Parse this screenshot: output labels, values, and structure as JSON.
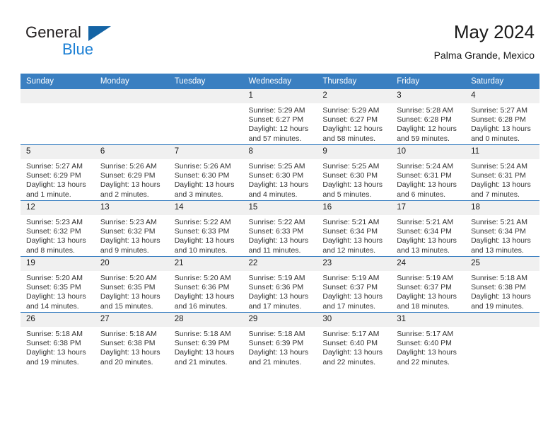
{
  "brand": {
    "name_part1": "General",
    "name_part2": "Blue",
    "triangle_color": "#1464a5",
    "blue_color": "#1b7fd4"
  },
  "header": {
    "title": "May 2024",
    "subtitle": "Palma Grande, Mexico"
  },
  "theme": {
    "header_row_bg": "#3a7fc1",
    "daynum_bg": "#f0f0f0",
    "text_color": "#1a1a1a"
  },
  "calendar": {
    "weekday_headers": [
      "Sunday",
      "Monday",
      "Tuesday",
      "Wednesday",
      "Thursday",
      "Friday",
      "Saturday"
    ],
    "weeks": [
      [
        {
          "day": "",
          "sunrise": "",
          "sunset": "",
          "daylight1": "",
          "daylight2": ""
        },
        {
          "day": "",
          "sunrise": "",
          "sunset": "",
          "daylight1": "",
          "daylight2": ""
        },
        {
          "day": "",
          "sunrise": "",
          "sunset": "",
          "daylight1": "",
          "daylight2": ""
        },
        {
          "day": "1",
          "sunrise": "Sunrise: 5:29 AM",
          "sunset": "Sunset: 6:27 PM",
          "daylight1": "Daylight: 12 hours",
          "daylight2": "and 57 minutes."
        },
        {
          "day": "2",
          "sunrise": "Sunrise: 5:29 AM",
          "sunset": "Sunset: 6:27 PM",
          "daylight1": "Daylight: 12 hours",
          "daylight2": "and 58 minutes."
        },
        {
          "day": "3",
          "sunrise": "Sunrise: 5:28 AM",
          "sunset": "Sunset: 6:28 PM",
          "daylight1": "Daylight: 12 hours",
          "daylight2": "and 59 minutes."
        },
        {
          "day": "4",
          "sunrise": "Sunrise: 5:27 AM",
          "sunset": "Sunset: 6:28 PM",
          "daylight1": "Daylight: 13 hours",
          "daylight2": "and 0 minutes."
        }
      ],
      [
        {
          "day": "5",
          "sunrise": "Sunrise: 5:27 AM",
          "sunset": "Sunset: 6:29 PM",
          "daylight1": "Daylight: 13 hours",
          "daylight2": "and 1 minute."
        },
        {
          "day": "6",
          "sunrise": "Sunrise: 5:26 AM",
          "sunset": "Sunset: 6:29 PM",
          "daylight1": "Daylight: 13 hours",
          "daylight2": "and 2 minutes."
        },
        {
          "day": "7",
          "sunrise": "Sunrise: 5:26 AM",
          "sunset": "Sunset: 6:30 PM",
          "daylight1": "Daylight: 13 hours",
          "daylight2": "and 3 minutes."
        },
        {
          "day": "8",
          "sunrise": "Sunrise: 5:25 AM",
          "sunset": "Sunset: 6:30 PM",
          "daylight1": "Daylight: 13 hours",
          "daylight2": "and 4 minutes."
        },
        {
          "day": "9",
          "sunrise": "Sunrise: 5:25 AM",
          "sunset": "Sunset: 6:30 PM",
          "daylight1": "Daylight: 13 hours",
          "daylight2": "and 5 minutes."
        },
        {
          "day": "10",
          "sunrise": "Sunrise: 5:24 AM",
          "sunset": "Sunset: 6:31 PM",
          "daylight1": "Daylight: 13 hours",
          "daylight2": "and 6 minutes."
        },
        {
          "day": "11",
          "sunrise": "Sunrise: 5:24 AM",
          "sunset": "Sunset: 6:31 PM",
          "daylight1": "Daylight: 13 hours",
          "daylight2": "and 7 minutes."
        }
      ],
      [
        {
          "day": "12",
          "sunrise": "Sunrise: 5:23 AM",
          "sunset": "Sunset: 6:32 PM",
          "daylight1": "Daylight: 13 hours",
          "daylight2": "and 8 minutes."
        },
        {
          "day": "13",
          "sunrise": "Sunrise: 5:23 AM",
          "sunset": "Sunset: 6:32 PM",
          "daylight1": "Daylight: 13 hours",
          "daylight2": "and 9 minutes."
        },
        {
          "day": "14",
          "sunrise": "Sunrise: 5:22 AM",
          "sunset": "Sunset: 6:33 PM",
          "daylight1": "Daylight: 13 hours",
          "daylight2": "and 10 minutes."
        },
        {
          "day": "15",
          "sunrise": "Sunrise: 5:22 AM",
          "sunset": "Sunset: 6:33 PM",
          "daylight1": "Daylight: 13 hours",
          "daylight2": "and 11 minutes."
        },
        {
          "day": "16",
          "sunrise": "Sunrise: 5:21 AM",
          "sunset": "Sunset: 6:34 PM",
          "daylight1": "Daylight: 13 hours",
          "daylight2": "and 12 minutes."
        },
        {
          "day": "17",
          "sunrise": "Sunrise: 5:21 AM",
          "sunset": "Sunset: 6:34 PM",
          "daylight1": "Daylight: 13 hours",
          "daylight2": "and 13 minutes."
        },
        {
          "day": "18",
          "sunrise": "Sunrise: 5:21 AM",
          "sunset": "Sunset: 6:34 PM",
          "daylight1": "Daylight: 13 hours",
          "daylight2": "and 13 minutes."
        }
      ],
      [
        {
          "day": "19",
          "sunrise": "Sunrise: 5:20 AM",
          "sunset": "Sunset: 6:35 PM",
          "daylight1": "Daylight: 13 hours",
          "daylight2": "and 14 minutes."
        },
        {
          "day": "20",
          "sunrise": "Sunrise: 5:20 AM",
          "sunset": "Sunset: 6:35 PM",
          "daylight1": "Daylight: 13 hours",
          "daylight2": "and 15 minutes."
        },
        {
          "day": "21",
          "sunrise": "Sunrise: 5:20 AM",
          "sunset": "Sunset: 6:36 PM",
          "daylight1": "Daylight: 13 hours",
          "daylight2": "and 16 minutes."
        },
        {
          "day": "22",
          "sunrise": "Sunrise: 5:19 AM",
          "sunset": "Sunset: 6:36 PM",
          "daylight1": "Daylight: 13 hours",
          "daylight2": "and 17 minutes."
        },
        {
          "day": "23",
          "sunrise": "Sunrise: 5:19 AM",
          "sunset": "Sunset: 6:37 PM",
          "daylight1": "Daylight: 13 hours",
          "daylight2": "and 17 minutes."
        },
        {
          "day": "24",
          "sunrise": "Sunrise: 5:19 AM",
          "sunset": "Sunset: 6:37 PM",
          "daylight1": "Daylight: 13 hours",
          "daylight2": "and 18 minutes."
        },
        {
          "day": "25",
          "sunrise": "Sunrise: 5:18 AM",
          "sunset": "Sunset: 6:38 PM",
          "daylight1": "Daylight: 13 hours",
          "daylight2": "and 19 minutes."
        }
      ],
      [
        {
          "day": "26",
          "sunrise": "Sunrise: 5:18 AM",
          "sunset": "Sunset: 6:38 PM",
          "daylight1": "Daylight: 13 hours",
          "daylight2": "and 19 minutes."
        },
        {
          "day": "27",
          "sunrise": "Sunrise: 5:18 AM",
          "sunset": "Sunset: 6:38 PM",
          "daylight1": "Daylight: 13 hours",
          "daylight2": "and 20 minutes."
        },
        {
          "day": "28",
          "sunrise": "Sunrise: 5:18 AM",
          "sunset": "Sunset: 6:39 PM",
          "daylight1": "Daylight: 13 hours",
          "daylight2": "and 21 minutes."
        },
        {
          "day": "29",
          "sunrise": "Sunrise: 5:18 AM",
          "sunset": "Sunset: 6:39 PM",
          "daylight1": "Daylight: 13 hours",
          "daylight2": "and 21 minutes."
        },
        {
          "day": "30",
          "sunrise": "Sunrise: 5:17 AM",
          "sunset": "Sunset: 6:40 PM",
          "daylight1": "Daylight: 13 hours",
          "daylight2": "and 22 minutes."
        },
        {
          "day": "31",
          "sunrise": "Sunrise: 5:17 AM",
          "sunset": "Sunset: 6:40 PM",
          "daylight1": "Daylight: 13 hours",
          "daylight2": "and 22 minutes."
        },
        {
          "day": "",
          "sunrise": "",
          "sunset": "",
          "daylight1": "",
          "daylight2": ""
        }
      ]
    ]
  }
}
